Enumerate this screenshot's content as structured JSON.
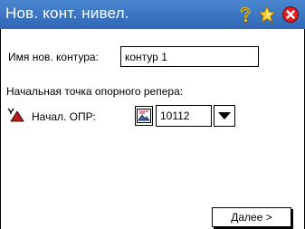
{
  "window": {
    "title": "Нов. конт. нивел.",
    "title_bar_color": "#3572c0",
    "icons": [
      "help-icon",
      "favorite-icon",
      "close-icon"
    ]
  },
  "form": {
    "contour_name_label": "Имя нов. контура:",
    "contour_name_value": "контур 1",
    "start_point_heading": "Начальная точка опорного репера:",
    "start_opr_label": "Начал. ОПР:",
    "start_opr_value": "10112"
  },
  "footer": {
    "next_label": "Далее >"
  }
}
